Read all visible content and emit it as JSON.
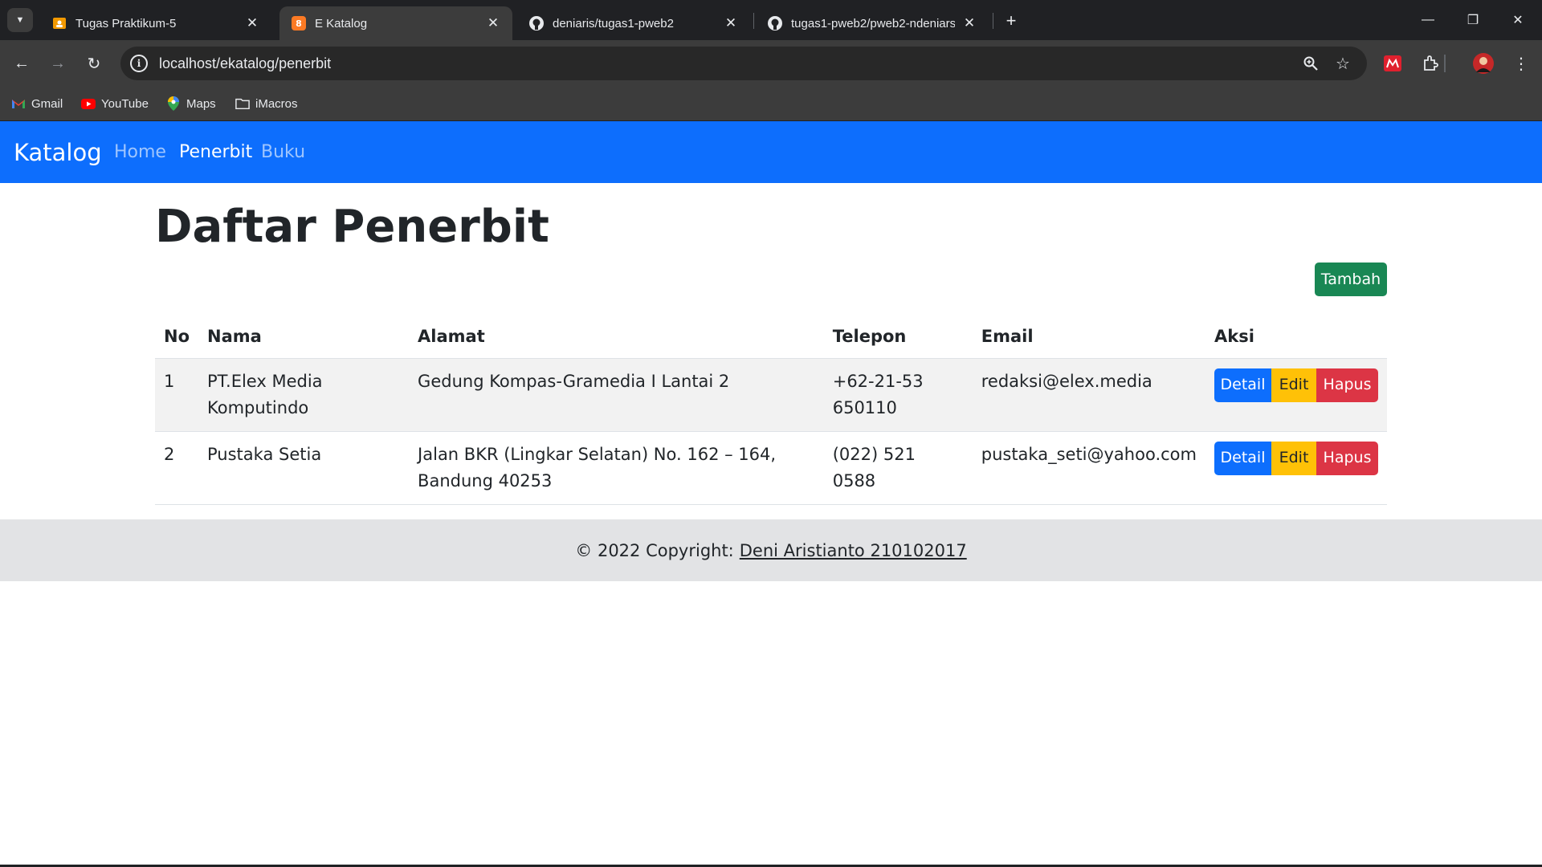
{
  "browser": {
    "tabs": [
      {
        "title": "Tugas Praktikum-5",
        "icon": "classroom-icon"
      },
      {
        "title": "E Katalog",
        "icon": "xampp-icon",
        "active": true
      },
      {
        "title": "deniaris/tugas1-pweb2",
        "icon": "github-icon"
      },
      {
        "title": "tugas1-pweb2/pweb2-ndeniars",
        "icon": "github-icon"
      }
    ],
    "url": "localhost/ekatalog/penerbit",
    "bookmarks": [
      {
        "label": "Gmail",
        "icon": "gmail-icon"
      },
      {
        "label": "YouTube",
        "icon": "youtube-icon"
      },
      {
        "label": "Maps",
        "icon": "maps-icon"
      },
      {
        "label": "iMacros",
        "icon": "folder-icon"
      }
    ]
  },
  "navbar": {
    "brand": "Katalog",
    "links": [
      {
        "label": "Home",
        "active": false
      },
      {
        "label": "Penerbit",
        "active": true
      },
      {
        "label": "Buku",
        "active": false
      }
    ]
  },
  "page": {
    "title": "Daftar Penerbit",
    "add_button": "Tambah"
  },
  "table": {
    "headers": [
      "No",
      "Nama",
      "Alamat",
      "Telepon",
      "Email",
      "Aksi"
    ],
    "rows": [
      {
        "no": "1",
        "nama": "PT.Elex Media Komputindo",
        "alamat": "Gedung Kompas-Gramedia I Lantai 2",
        "telepon": "+62-21-53650110",
        "email": "redaksi@elex.media"
      },
      {
        "no": "2",
        "nama": "Pustaka Setia",
        "alamat": "Jalan BKR (Lingkar Selatan) No. 162 – 164, Bandung 40253",
        "telepon": "(022) 521 0588",
        "email": "pustaka_seti@yahoo.com"
      }
    ],
    "actions": {
      "detail": "Detail",
      "edit": "Edit",
      "hapus": "Hapus"
    }
  },
  "footer": {
    "text": "© 2022 Copyright:",
    "link": "Deni Aristianto 210102017"
  },
  "colors": {
    "primary": "#0d6efd",
    "success": "#198754",
    "warning": "#ffc107",
    "danger": "#dc3545",
    "footer_bg": "#e2e3e5"
  }
}
